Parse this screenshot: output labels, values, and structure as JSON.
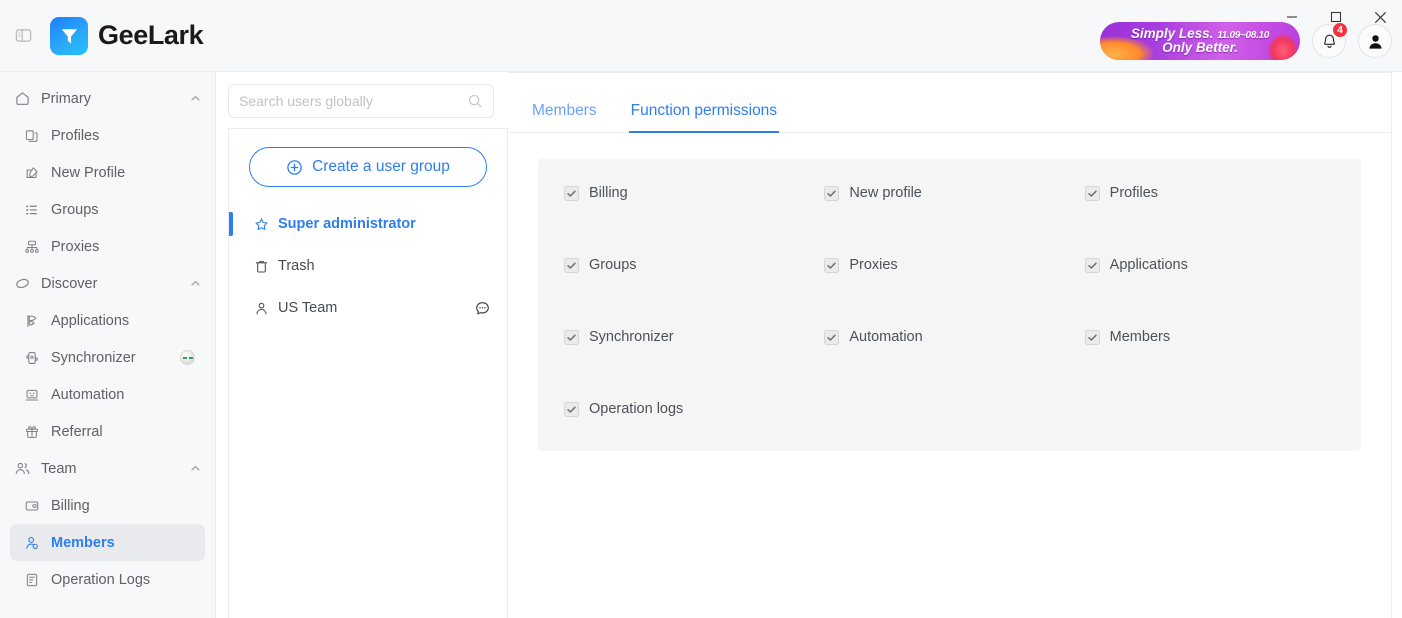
{
  "app": {
    "brand_name": "GeeLark",
    "panel_toggle_icon": "sidebar-toggle-icon"
  },
  "window_controls": {
    "minimize": "minimize-icon",
    "maximize": "maximize-icon",
    "close": "close-icon"
  },
  "header": {
    "promo": {
      "line1": "Simply Less.",
      "date_range": "11.09~08.10",
      "line2": "Only Better."
    },
    "notifications": {
      "icon": "bell-icon",
      "badge_count": "4"
    },
    "avatar": {
      "icon": "user-avatar-icon"
    }
  },
  "sidebar": {
    "groups": [
      {
        "label": "Primary",
        "icon": "home-icon",
        "chevron": "chevron-up-icon",
        "items": [
          {
            "label": "Profiles",
            "icon": "profiles-icon",
            "active": false
          },
          {
            "label": "New Profile",
            "icon": "new-profile-icon",
            "active": false
          },
          {
            "label": "Groups",
            "icon": "groups-list-icon",
            "active": false
          },
          {
            "label": "Proxies",
            "icon": "proxies-icon",
            "active": false
          }
        ]
      },
      {
        "label": "Discover",
        "icon": "cloud-icon",
        "chevron": "chevron-up-icon",
        "items": [
          {
            "label": "Applications",
            "icon": "applications-icon",
            "active": false
          },
          {
            "label": "Synchronizer",
            "icon": "synchronizer-icon",
            "active": false,
            "status_dot": true
          },
          {
            "label": "Automation",
            "icon": "automation-icon",
            "active": false
          },
          {
            "label": "Referral",
            "icon": "gift-icon",
            "active": false
          }
        ]
      },
      {
        "label": "Team",
        "icon": "team-icon",
        "chevron": "chevron-up-icon",
        "items": [
          {
            "label": "Billing",
            "icon": "billing-icon",
            "active": false
          },
          {
            "label": "Members",
            "icon": "members-icon",
            "active": true
          },
          {
            "label": "Operation Logs",
            "icon": "operation-logs-icon",
            "active": false
          }
        ]
      }
    ]
  },
  "search": {
    "placeholder": "Search users globally",
    "value": "",
    "icon": "search-icon"
  },
  "group_panel": {
    "create_button": {
      "label": "Create a user group",
      "icon": "plus-circle-icon"
    },
    "items": [
      {
        "label": "Super administrator",
        "icon": "star-icon",
        "selected": true,
        "menu": false
      },
      {
        "label": "Trash",
        "icon": "trash-icon",
        "selected": false,
        "menu": false
      },
      {
        "label": "US Team",
        "icon": "person-icon",
        "selected": false,
        "menu": true,
        "menu_icon": "chat-dots-icon"
      }
    ]
  },
  "main": {
    "tabs": [
      {
        "label": "Members",
        "active": false
      },
      {
        "label": "Function permissions",
        "active": true
      }
    ],
    "permissions": [
      {
        "label": "Billing",
        "checked": true
      },
      {
        "label": "New profile",
        "checked": true
      },
      {
        "label": "Profiles",
        "checked": true
      },
      {
        "label": "Groups",
        "checked": true
      },
      {
        "label": "Proxies",
        "checked": true
      },
      {
        "label": "Applications",
        "checked": true
      },
      {
        "label": "Synchronizer",
        "checked": true
      },
      {
        "label": "Automation",
        "checked": true
      },
      {
        "label": "Members",
        "checked": true
      },
      {
        "label": "Operation logs",
        "checked": true
      }
    ]
  },
  "colors": {
    "accent": "#2e7ef0",
    "badge_red": "#f5333f",
    "sidebar_bg": "#f7f8f9",
    "card_bg": "#f5f5f5"
  }
}
